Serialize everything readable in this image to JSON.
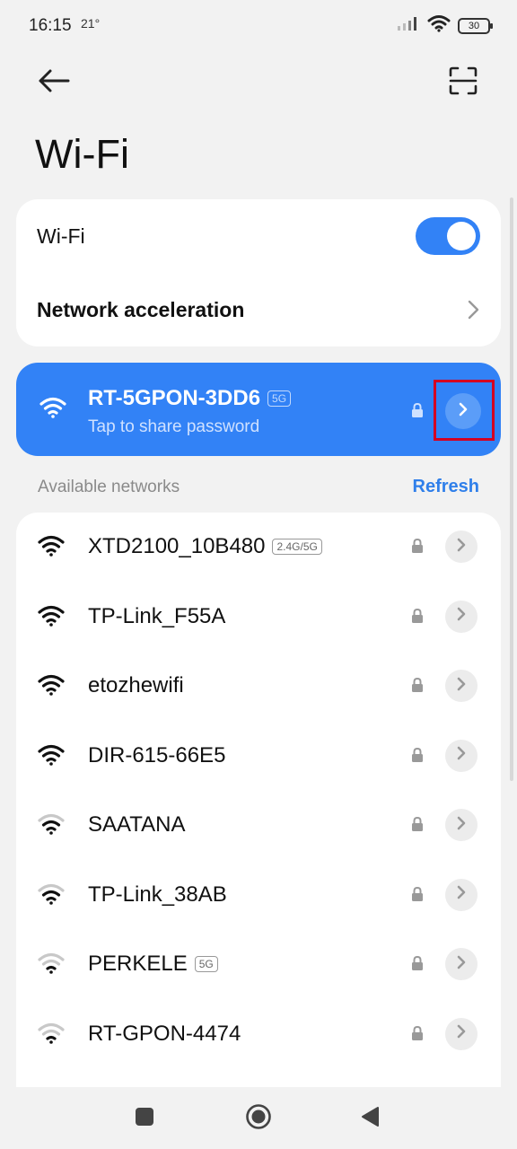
{
  "status_bar": {
    "time": "16:15",
    "temperature": "21°",
    "battery": "30",
    "icons": [
      "signal-icon",
      "wifi-icon",
      "battery-icon"
    ]
  },
  "header": {
    "title": "Wi-Fi",
    "back_icon": "arrow-left-icon",
    "scan_icon": "qr-scan-icon"
  },
  "settings": {
    "wifi_label": "Wi-Fi",
    "wifi_enabled": true,
    "network_acceleration_label": "Network acceleration"
  },
  "connected_network": {
    "name": "RT-5GPON-3DD6",
    "band": "5G",
    "subtitle": "Tap to share password",
    "secured": true
  },
  "available": {
    "heading": "Available networks",
    "refresh_label": "Refresh",
    "networks": [
      {
        "name": "XTD2100_10B480",
        "band": "2.4G/5G",
        "signal": 4
      },
      {
        "name": "TP-Link_F55A",
        "band": "",
        "signal": 4
      },
      {
        "name": "etozhewifi",
        "band": "",
        "signal": 4
      },
      {
        "name": "DIR-615-66E5",
        "band": "",
        "signal": 4
      },
      {
        "name": "SAATANA",
        "band": "",
        "signal": 3
      },
      {
        "name": "TP-Link_38AB",
        "band": "",
        "signal": 3
      },
      {
        "name": "PERKELE",
        "band": "5G",
        "signal": 2
      },
      {
        "name": "RT-GPON-4474",
        "band": "",
        "signal": 2
      }
    ]
  },
  "colors": {
    "accent": "#3282f6",
    "background": "#f2f2f2",
    "highlight_box": "#d40022"
  }
}
